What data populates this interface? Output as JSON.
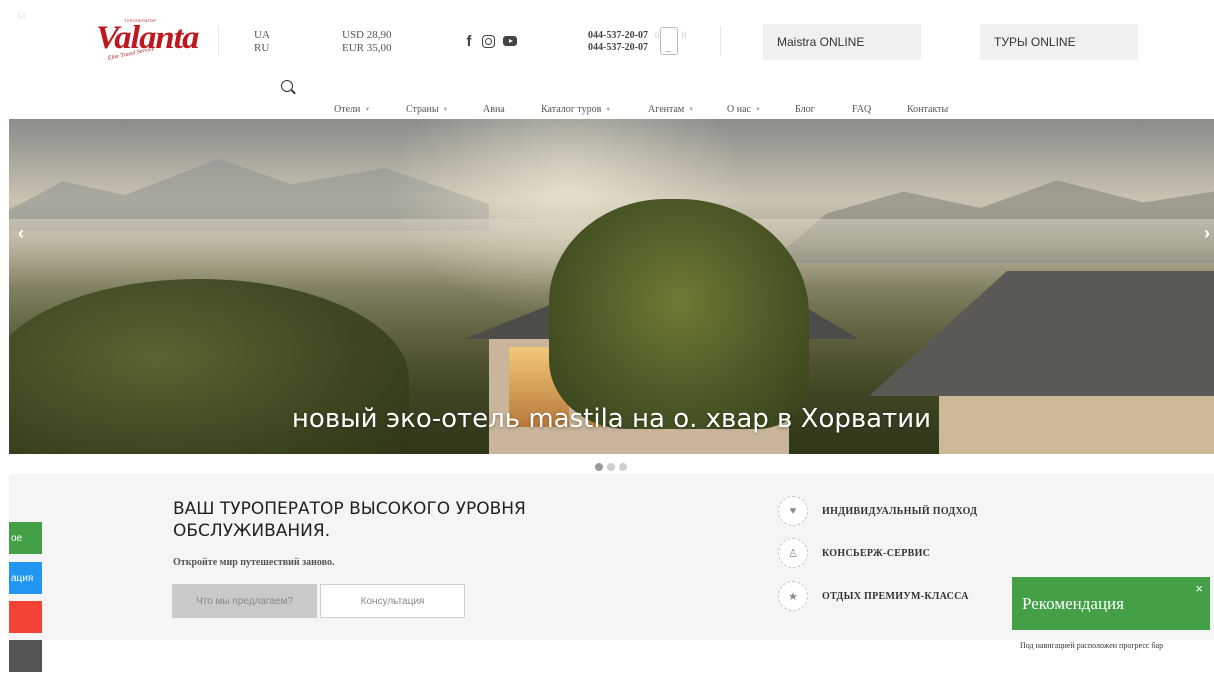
{
  "corner_text": "UI",
  "logo": {
    "small": "ТУРОПЕРАТОР",
    "main": "Valanta",
    "tagline": "Elite Travel Service"
  },
  "languages": [
    "UA",
    "RU"
  ],
  "rates": {
    "usd": "USD 28,90",
    "eur": "EUR 35,00"
  },
  "social": [
    {
      "icon": "facebook-icon",
      "label": "f"
    },
    {
      "icon": "instagram-icon"
    },
    {
      "icon": "youtube-icon"
    }
  ],
  "phones": [
    "044-537-20-07",
    "044-537-20-07"
  ],
  "cta": {
    "maistra": "Maistra ONLINE",
    "tours": "ТУРЫ ONLINE"
  },
  "nav": [
    {
      "label": "Отели",
      "dropdown": true
    },
    {
      "label": "Страны",
      "dropdown": true
    },
    {
      "label": "Авиа",
      "dropdown": false
    },
    {
      "label": "Каталог туров",
      "dropdown": true
    },
    {
      "label": "Агентам",
      "dropdown": true
    },
    {
      "label": "О нас",
      "dropdown": true
    },
    {
      "label": "Блог",
      "dropdown": false
    },
    {
      "label": "FAQ",
      "dropdown": false
    },
    {
      "label": "Контакты",
      "dropdown": false
    }
  ],
  "hero": {
    "caption": "новый эко-отель mastila на о. хвар в Хорватии",
    "prev": "‹",
    "next": "›",
    "slides": 3,
    "active_slide": 1
  },
  "intro": {
    "title": "ВАШ ТУРОПЕРАТОР ВЫСОКОГО УРОВНЯ ОБСЛУЖИВАНИЯ.",
    "subtitle": "Откройте мир путешествий заново.",
    "btn_what": "Что мы предлагаем?",
    "btn_consult": "Консультация"
  },
  "features": [
    {
      "label": "ИНДИВИДУАЛЬНЫЙ ПОДХОД",
      "icon": "hand-heart-icon"
    },
    {
      "label": "КОНСЬЕРЖ-СЕРВИС",
      "icon": "concierge-icon"
    },
    {
      "label": "ОТДЫХ ПРЕМИУМ-КЛАССА",
      "icon": "star-icon"
    }
  ],
  "side_tabs": [
    {
      "label": "ое",
      "color": "#43a047"
    },
    {
      "label": "ация",
      "color": "#2196f3"
    },
    {
      "label": "",
      "color": "#f44336"
    },
    {
      "label": "",
      "color": "#555555"
    }
  ],
  "recommendation": {
    "title": "Рекомендация",
    "close": "×",
    "text": "Под навигацией расположен прогресс бар"
  }
}
